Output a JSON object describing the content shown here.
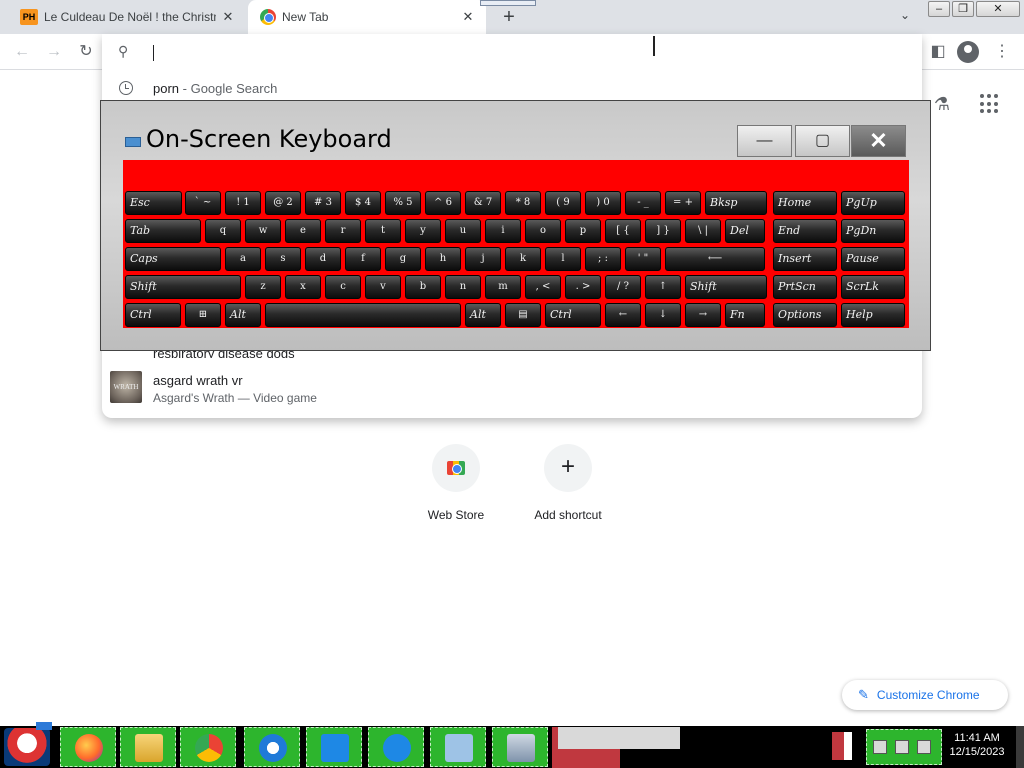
{
  "browser": {
    "tabs": [
      {
        "favicon": "PH",
        "title": "Le Culdeau De Noël ! the Christmas...",
        "close": "✕"
      },
      {
        "favicon": "chrome-icon",
        "title": "New Tab",
        "close": "✕"
      }
    ],
    "new_tab": "+",
    "tab_search": "⌄",
    "window_controls": {
      "minimize": "‒",
      "maximize": "❐",
      "close": "✕"
    }
  },
  "toolbar": {
    "back": "←",
    "forward": "→",
    "reload": "↻",
    "side_panel": "◧",
    "menu": "⋮"
  },
  "omnibox": {
    "search_icon": "⚲",
    "suggestions": [
      {
        "text": "porn",
        "desc": " - Google Search"
      },
      {
        "text": "respiratory disease dogs"
      },
      {
        "title": "asgard wrath vr",
        "subtitle": "Asgard's Wrath — Video game",
        "thumb": "WRATH"
      }
    ]
  },
  "ntp": {
    "labs": "⚗",
    "shortcuts": [
      {
        "label": "Web Store"
      },
      {
        "label": "Add shortcut",
        "icon": "+"
      }
    ],
    "customize": {
      "label": "Customize Chrome",
      "icon": "✎"
    }
  },
  "osk": {
    "title": "On-Screen Keyboard",
    "controls": {
      "minimize": "—",
      "maximize": "▢",
      "close": "✕"
    },
    "accent": "#ff0000",
    "rows": [
      [
        "Esc",
        "` ~",
        "! 1",
        "@ 2",
        "# 3",
        "$ 4",
        "% 5",
        "^ 6",
        "& 7",
        "* 8",
        "( 9",
        ") 0",
        "- _",
        "= +",
        "Bksp",
        "Home",
        "PgUp"
      ],
      [
        "Tab",
        "q",
        "w",
        "e",
        "r",
        "t",
        "y",
        "u",
        "i",
        "o",
        "p",
        "[ {",
        "] }",
        "\\ |",
        "Del",
        "End",
        "PgDn"
      ],
      [
        "Caps",
        "a",
        "s",
        "d",
        "f",
        "g",
        "h",
        "j",
        "k",
        "l",
        "; :",
        "' \"",
        "⟵",
        "Insert",
        "Pause"
      ],
      [
        "Shift",
        "z",
        "x",
        "c",
        "v",
        "b",
        "n",
        "m",
        ", <",
        ". >",
        "/ ?",
        "↑",
        "Shift",
        "PrtScn",
        "ScrLk"
      ],
      [
        "Ctrl",
        "⊞",
        "Alt",
        "",
        "Alt",
        "▤",
        "Ctrl",
        "←",
        "↓",
        "→",
        "Fn",
        "Options",
        "Help"
      ]
    ]
  },
  "taskbar": {
    "apps": [
      "firefox",
      "file-explorer",
      "chrome",
      "security",
      "download",
      "chat",
      "box",
      "on-screen-keyboard"
    ],
    "clock": {
      "time": "11:41 AM",
      "date": "12/15/2023"
    }
  }
}
